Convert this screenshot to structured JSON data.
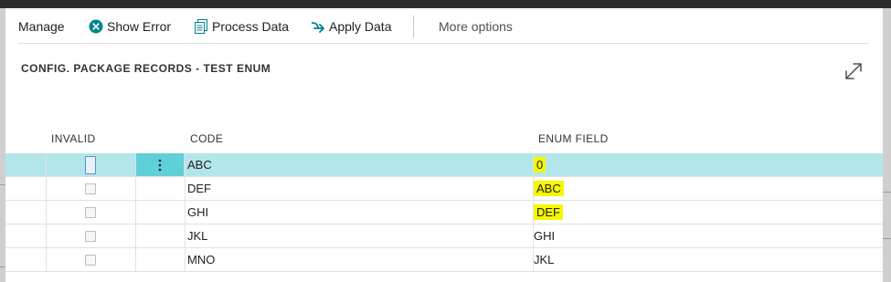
{
  "actions": {
    "manage": "Manage",
    "show_error": "Show Error",
    "process_data": "Process Data",
    "apply_data": "Apply Data",
    "more_options": "More options"
  },
  "page": {
    "caption": "CONFIG. PACKAGE RECORDS - TEST ENUM"
  },
  "table": {
    "columns": {
      "invalid": "INVALID",
      "code": "CODE",
      "enum_field": "ENUM FIELD"
    },
    "rows": [
      {
        "invalid": false,
        "code": "ABC",
        "enum_field": "0",
        "enum_highlighted": true,
        "selected": true
      },
      {
        "invalid": false,
        "code": "DEF",
        "enum_field": "ABC",
        "enum_highlighted": true,
        "selected": false
      },
      {
        "invalid": false,
        "code": "GHI",
        "enum_field": "DEF",
        "enum_highlighted": true,
        "selected": false
      },
      {
        "invalid": false,
        "code": "JKL",
        "enum_field": "GHI",
        "enum_highlighted": false,
        "selected": false
      },
      {
        "invalid": false,
        "code": "MNO",
        "enum_field": "JKL",
        "enum_highlighted": false,
        "selected": false
      }
    ]
  },
  "colors": {
    "selected_row": "#b3e6ea",
    "row_menu": "#5fcfd8",
    "highlight": "#f6f600",
    "icon_teal": "#00838f"
  },
  "icons": {
    "show_error": "error-x-circle-icon",
    "process_data": "process-data-icon",
    "apply_data": "apply-arrow-icon",
    "expand": "expand-icon",
    "row_menu": "vertical-dots-icon"
  }
}
